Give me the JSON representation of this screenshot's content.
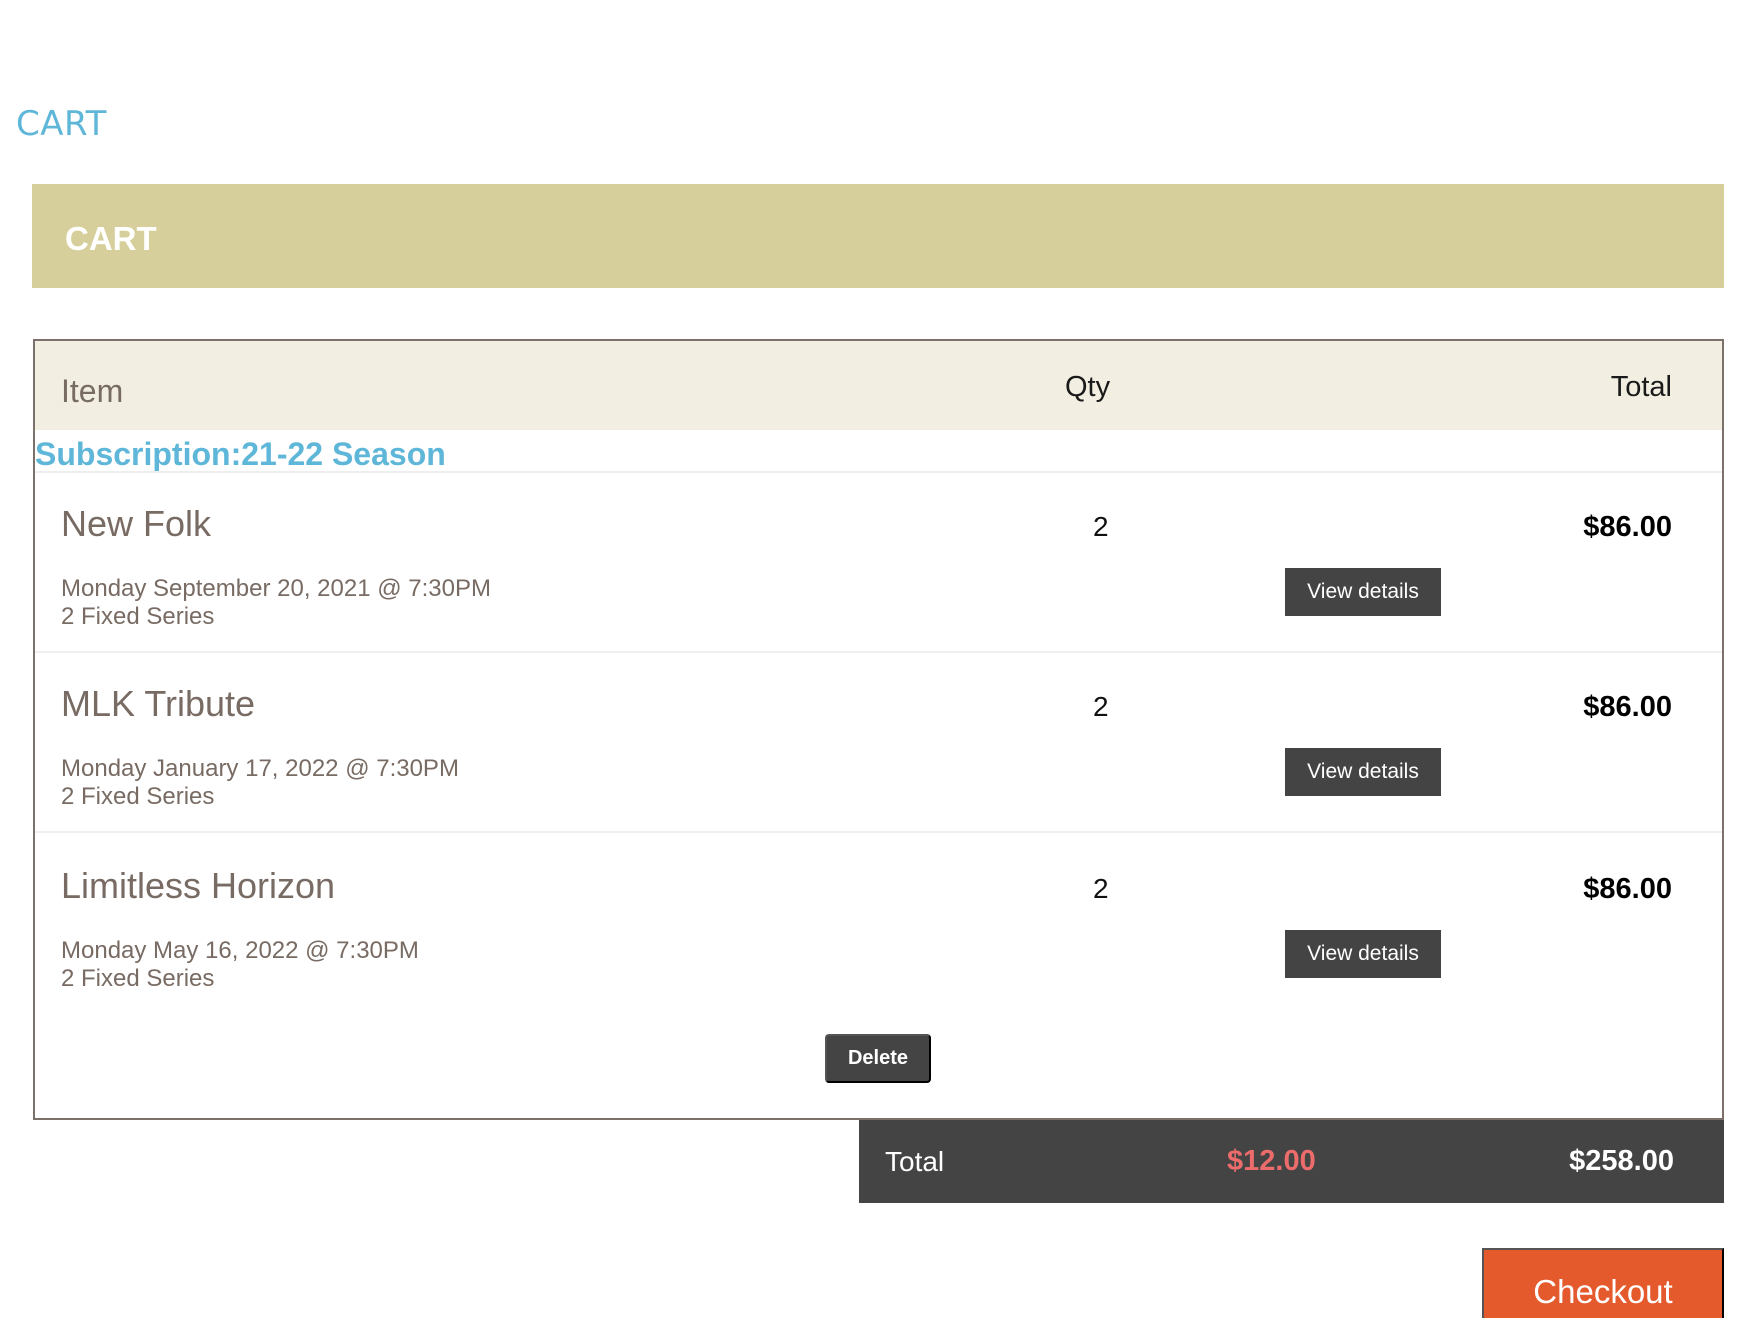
{
  "page": {
    "heading": "CART"
  },
  "banner": {
    "title": "CART"
  },
  "table": {
    "headers": {
      "item": "Item",
      "qty": "Qty",
      "total": "Total"
    },
    "group_title": "Subscription:21-22 Season",
    "rows": [
      {
        "name": "New Folk",
        "date": "Monday September 20, 2021 @ 7:30PM",
        "series": "2 Fixed Series",
        "qty": "2",
        "total": "$86.00",
        "details_label": "View details"
      },
      {
        "name": "MLK Tribute",
        "date": "Monday January 17, 2022 @ 7:30PM",
        "series": "2 Fixed Series",
        "qty": "2",
        "total": "$86.00",
        "details_label": "View details"
      },
      {
        "name": "Limitless Horizon",
        "date": "Monday May 16, 2022 @ 7:30PM",
        "series": "2 Fixed Series",
        "qty": "2",
        "total": "$86.00",
        "details_label": "View details"
      }
    ],
    "delete_label": "Delete"
  },
  "summary": {
    "label": "Total",
    "discount": "$12.00",
    "amount": "$258.00"
  },
  "checkout": {
    "label": "Checkout"
  },
  "colors": {
    "accent_blue": "#5eb6d8",
    "banner": "#d6cf9c",
    "header_row": "#f2efe2",
    "dark_button": "#444444",
    "discount_red": "#ec6c6c",
    "checkout_orange": "#e45a2c"
  }
}
